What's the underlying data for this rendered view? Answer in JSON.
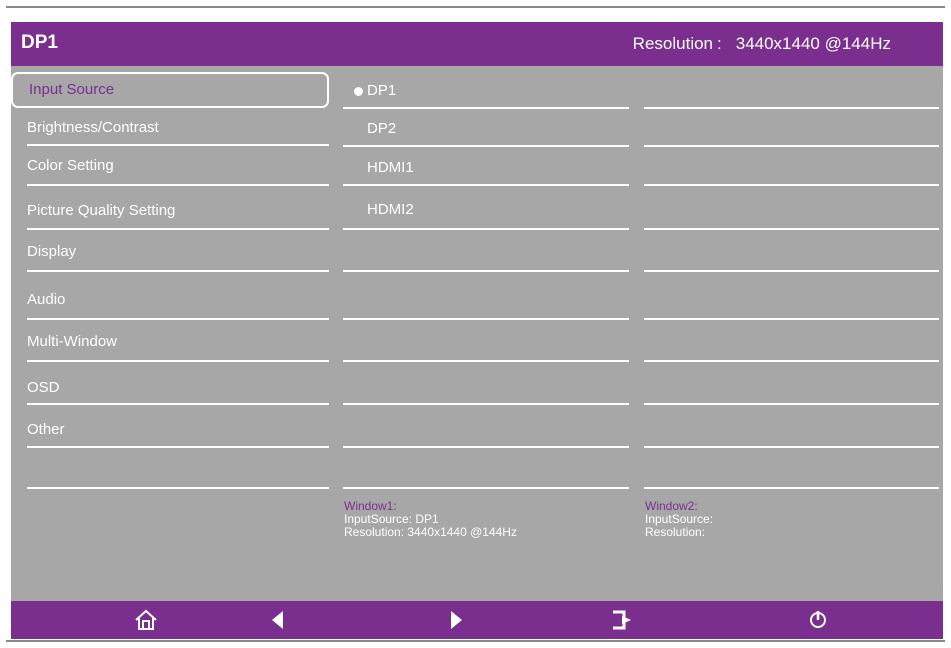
{
  "header": {
    "title": "DP1",
    "resolution_label": "Resolution",
    "resolution_value": "3440x1440 @144Hz"
  },
  "menu": [
    {
      "label": "Input Source",
      "selected": true
    },
    {
      "label": "Brightness/Contrast"
    },
    {
      "label": "Color Setting"
    },
    {
      "label": "Picture Quality Setting"
    },
    {
      "label": "Display"
    },
    {
      "label": "Audio"
    },
    {
      "label": "Multi-Window"
    },
    {
      "label": "OSD"
    },
    {
      "label": "Other"
    }
  ],
  "submenu": [
    {
      "label": "DP1",
      "selected": true
    },
    {
      "label": "DP2"
    },
    {
      "label": "HDMI1"
    },
    {
      "label": "HDMI2"
    }
  ],
  "window1": {
    "title": "Window1:",
    "input": "InputSource: DP1",
    "resolution": "Resolution: 3440x1440 @144Hz"
  },
  "window2": {
    "title": "Window2:",
    "input": "InputSource:",
    "resolution": "Resolution:"
  },
  "footer": {
    "icons": [
      "home-icon",
      "left-arrow-icon",
      "right-arrow-icon",
      "exit-icon",
      "power-icon"
    ]
  },
  "colors": {
    "accent": "#7a2f8f",
    "panel": "#a7a7a7",
    "text": "#ffffff"
  }
}
